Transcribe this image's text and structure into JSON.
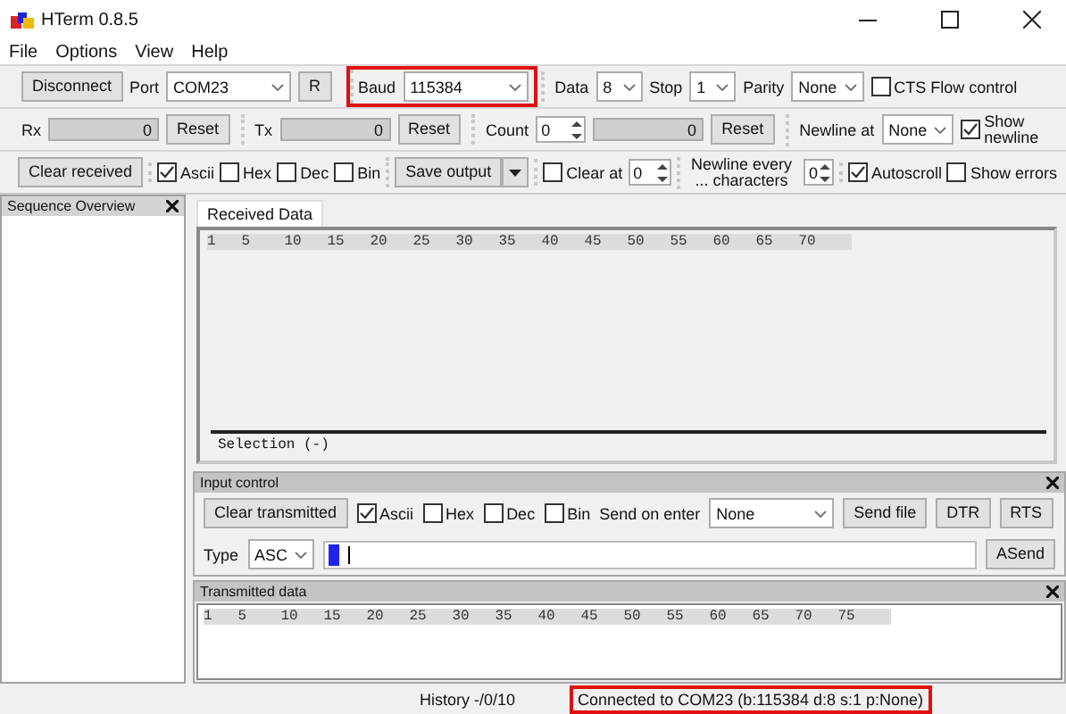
{
  "window": {
    "title": "HTerm 0.8.5"
  },
  "menu": [
    "File",
    "Options",
    "View",
    "Help"
  ],
  "toolbar_rows": [
    [
      [
        {
          "kind": "button",
          "label": "Disconnect"
        },
        {
          "kind": "label",
          "label": "Port"
        },
        {
          "kind": "combo",
          "value": "COM23"
        },
        {
          "kind": "button",
          "label": "R"
        }
      ],
      [
        {
          "kind": "label",
          "label": "Baud",
          "highlighted": true
        },
        {
          "kind": "combo",
          "value": "115384",
          "highlighted": true
        }
      ],
      [
        {
          "kind": "label",
          "label": "Data"
        },
        {
          "kind": "combo",
          "value": "8"
        },
        {
          "kind": "label",
          "label": "Stop"
        },
        {
          "kind": "combo",
          "value": "1"
        },
        {
          "kind": "label",
          "label": "Parity"
        },
        {
          "kind": "combo",
          "value": "None"
        },
        {
          "kind": "check",
          "label": "CTS Flow control",
          "checked": false
        }
      ]
    ],
    [
      [
        {
          "kind": "label",
          "label": "Rx"
        },
        {
          "kind": "readout",
          "value": "0"
        },
        {
          "kind": "button",
          "label": "Reset"
        }
      ],
      [
        {
          "kind": "label",
          "label": "Tx"
        },
        {
          "kind": "readout",
          "value": "0"
        },
        {
          "kind": "button",
          "label": "Reset"
        }
      ],
      [
        {
          "kind": "label",
          "label": "Count"
        },
        {
          "kind": "spin",
          "value": "0"
        },
        {
          "kind": "readout",
          "value": "0"
        },
        {
          "kind": "button",
          "label": "Reset"
        }
      ],
      [
        {
          "kind": "label",
          "label": "Newline at"
        },
        {
          "kind": "combo",
          "value": "None"
        },
        {
          "kind": "check",
          "label": "Show newline",
          "checked": true
        }
      ]
    ],
    [
      [
        {
          "kind": "button",
          "label": "Clear received"
        }
      ],
      [
        {
          "kind": "check",
          "label": "Ascii",
          "checked": true
        },
        {
          "kind": "check",
          "label": "Hex",
          "checked": false
        },
        {
          "kind": "check",
          "label": "Dec",
          "checked": false
        },
        {
          "kind": "check",
          "label": "Bin",
          "checked": false
        }
      ],
      [
        {
          "kind": "split",
          "label": "Save output"
        }
      ],
      [
        {
          "kind": "check",
          "label": "Clear at",
          "checked": false
        },
        {
          "kind": "spin",
          "value": "0"
        }
      ],
      [
        {
          "kind": "label",
          "label": "Newline every ... characters"
        },
        {
          "kind": "spin",
          "value": "0"
        }
      ],
      [
        {
          "kind": "check",
          "label": "Autoscroll",
          "checked": true
        },
        {
          "kind": "check",
          "label": "Show errors",
          "checked": false
        }
      ]
    ]
  ],
  "sequence_overview": {
    "title": "Sequence Overview"
  },
  "received": {
    "tab": {
      "label": "Received Data",
      "selected": true
    },
    "ruler": [
      "1",
      "5",
      "10",
      "15",
      "20",
      "25",
      "30",
      "35",
      "40",
      "45",
      "50",
      "55",
      "60",
      "65",
      "70"
    ],
    "selection": "Selection (-)"
  },
  "input_control": {
    "title": "Input control",
    "row1": [
      {
        "kind": "button",
        "label": "Clear transmitted"
      },
      {
        "kind": "check",
        "label": "Ascii",
        "checked": true
      },
      {
        "kind": "check",
        "label": "Hex",
        "checked": false
      },
      {
        "kind": "check",
        "label": "Dec",
        "checked": false
      },
      {
        "kind": "check",
        "label": "Bin",
        "checked": false
      },
      {
        "kind": "label",
        "label": "Send on enter"
      },
      {
        "kind": "combo",
        "value": "None"
      },
      {
        "kind": "button",
        "label": "Send file"
      },
      {
        "kind": "button",
        "label": "DTR"
      },
      {
        "kind": "button",
        "label": "RTS"
      }
    ],
    "type_label": "Type",
    "type_value": "ASC",
    "send": "ASend"
  },
  "transmitted": {
    "title": "Transmitted data",
    "ruler": [
      "1",
      "5",
      "10",
      "15",
      "20",
      "25",
      "30",
      "35",
      "40",
      "45",
      "50",
      "55",
      "60",
      "65",
      "70",
      "75"
    ]
  },
  "status_bar": {
    "history": "History -/0/10",
    "connection": {
      "text": "Connected to COM23 (b:115384 d:8 s:1 p:None)",
      "highlighted": true
    }
  }
}
